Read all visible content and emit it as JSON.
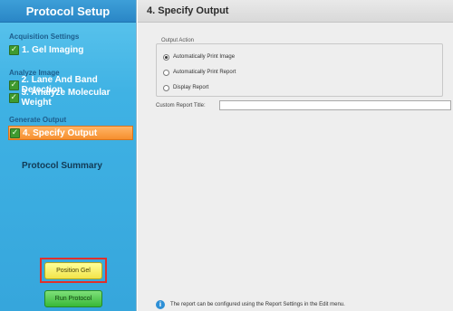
{
  "sidebar": {
    "title": "Protocol Setup",
    "groups": {
      "acquisition": "Acquisition Settings",
      "analyze": "Analyze Image",
      "generate": "Generate Output"
    },
    "steps": [
      {
        "label": "1. Gel Imaging",
        "checked": true
      },
      {
        "label": "2. Lane And Band Detection",
        "checked": true
      },
      {
        "label": "3. Analyze Molecular Weight",
        "checked": true
      },
      {
        "label": "4. Specify Output",
        "checked": true,
        "active": true
      }
    ],
    "summary": "Protocol Summary",
    "position_gel_button": "Position Gel",
    "run_protocol_button": "Run Protocol"
  },
  "main": {
    "title": "4. Specify Output",
    "output_action": {
      "legend": "Output Action",
      "options": [
        {
          "label": "Automatically Print Image",
          "selected": true
        },
        {
          "label": "Automatically Print Report",
          "selected": false
        },
        {
          "label": "Display Report",
          "selected": false
        }
      ]
    },
    "custom_report_title": {
      "label": "Custom Report Title:",
      "value": ""
    },
    "footer_note": "The report can be configured using the Report Settings in the Edit menu."
  },
  "colors": {
    "sidebar_blue": "#3fb2e4",
    "active_step_orange": "#f68f2e",
    "highlight_red": "#e0302b",
    "position_gel_yellow": "#f2e44a",
    "run_protocol_green": "#38b837"
  },
  "icons": {
    "check": "check-icon",
    "info": "info-icon"
  }
}
